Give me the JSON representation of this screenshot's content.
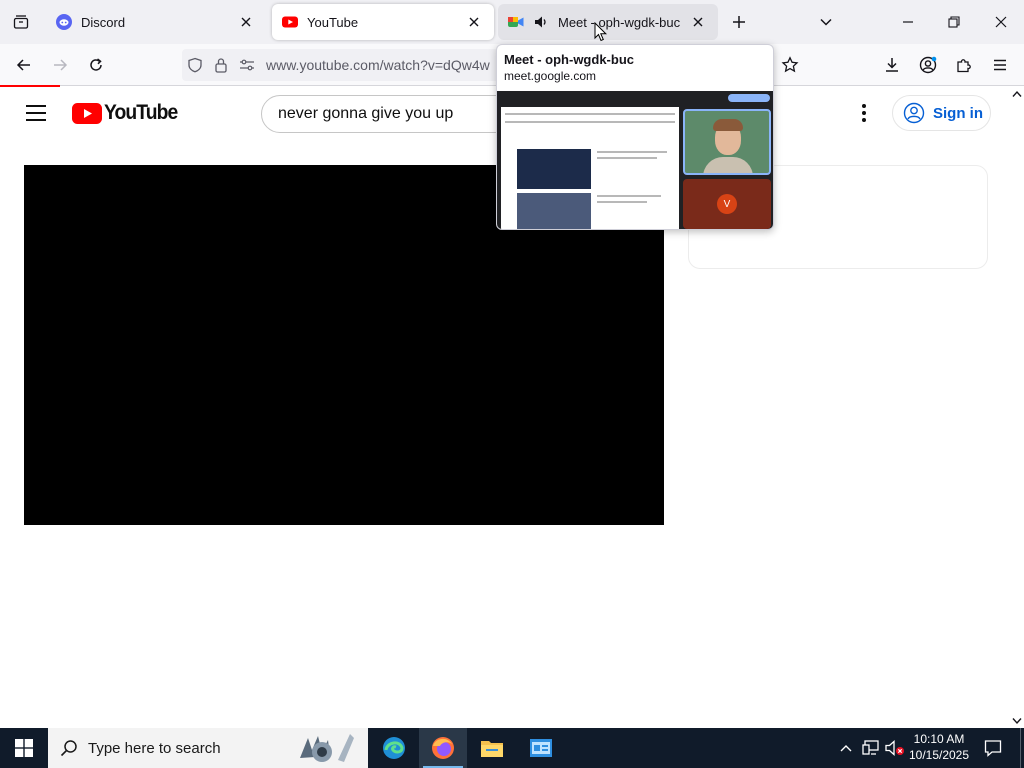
{
  "browser": {
    "tabs": [
      {
        "title": "Discord",
        "icon": "discord-icon",
        "active": false
      },
      {
        "title": "YouTube",
        "icon": "youtube-icon",
        "active": true
      },
      {
        "title": "Meet - oph-wgdk-buc",
        "icon": "google-meet-icon",
        "active": false,
        "audio": true
      }
    ],
    "url": "www.youtube.com/watch?v=dQw4w"
  },
  "tab_preview": {
    "title": "Meet - oph-wgdk-buc",
    "url": "meet.google.com"
  },
  "youtube": {
    "search_value": "never gonna give you up",
    "sign_in_label": "Sign in",
    "logo_text": "YouTube"
  },
  "taskbar": {
    "search_placeholder": "Type here to search",
    "time": "10:10 AM",
    "date": "10/15/2025"
  },
  "colors": {
    "youtube_red": "#ff0000",
    "link_blue": "#065fd4",
    "taskbar_bg": "#101b2a",
    "discord": "#5865f2"
  }
}
